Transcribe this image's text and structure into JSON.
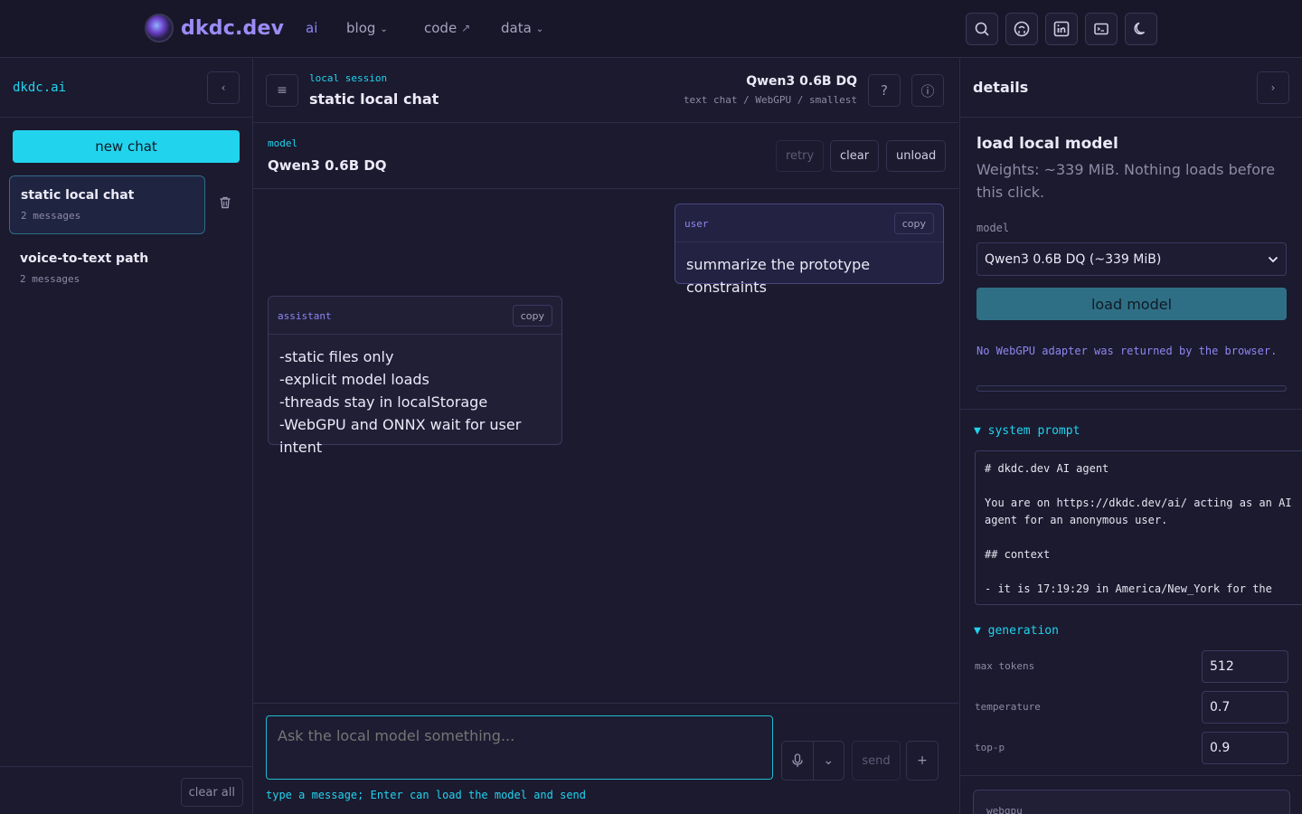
{
  "nav": {
    "brand": "dkdc.dev",
    "items": [
      {
        "label": "ai",
        "active": true
      },
      {
        "label": "blog"
      },
      {
        "label": "code"
      },
      {
        "label": "data"
      }
    ],
    "icons": [
      "search-icon",
      "github-icon",
      "linkedin-icon",
      "terminal-icon",
      "moon-icon"
    ]
  },
  "sidebar": {
    "title": "dkdc.ai",
    "new_chat": "new chat",
    "threads": [
      {
        "title": "static local chat",
        "sub": "2 messages",
        "active": true
      },
      {
        "title": "voice-to-text path",
        "sub": "2 messages"
      }
    ],
    "clear_all": "clear all"
  },
  "session": {
    "label": "local session",
    "title": "static local chat",
    "model_name": "Qwen3 0.6B DQ",
    "model_meta": "text chat / WebGPU / smallest",
    "help": "?",
    "info": "ⓘ"
  },
  "model_bar": {
    "label": "model",
    "value": "Qwen3 0.6B DQ",
    "retry": "retry",
    "clear": "clear",
    "unload": "unload"
  },
  "messages": [
    {
      "role": "user",
      "copy": "copy",
      "text": "summarize the prototype constraints"
    },
    {
      "role": "assistant",
      "copy": "copy",
      "lines": [
        "-static files only",
        "-explicit model loads",
        "-threads stay in localStorage",
        "-WebGPU and ONNX wait for user intent"
      ]
    }
  ],
  "composer": {
    "placeholder": "Ask the local model something...",
    "send": "send",
    "plus": "+",
    "dropdown": "⌄",
    "hint": "type a message; Enter can load the model and send"
  },
  "details": {
    "title": "details",
    "load_title": "load local model",
    "load_desc": "Weights: ~339 MiB. Nothing loads before this click.",
    "model_label": "model",
    "model_select": "Qwen3 0.6B DQ (~339 MiB)",
    "load_button": "load model",
    "status": "No WebGPU adapter was returned by the browser.",
    "progress": 0,
    "system_prompt_label": "system prompt",
    "system_prompt": "# dkdc.dev AI agent\n\nYou are on https://dkdc.dev/ai/ acting as an AI agent for an anonymous user.\n\n## context\n\n- it is 17:19:29 in America/New_York for the",
    "generation_label": "generation",
    "generation": [
      {
        "label": "max tokens",
        "value": "512"
      },
      {
        "label": "temperature",
        "value": "0.7"
      },
      {
        "label": "top-p",
        "value": "0.9"
      }
    ],
    "webgpu_label": "webgpu"
  },
  "colors": {
    "accent_cyan": "#22d3ee",
    "accent_violet": "#8f86f2",
    "background": "#1b1a2e"
  }
}
